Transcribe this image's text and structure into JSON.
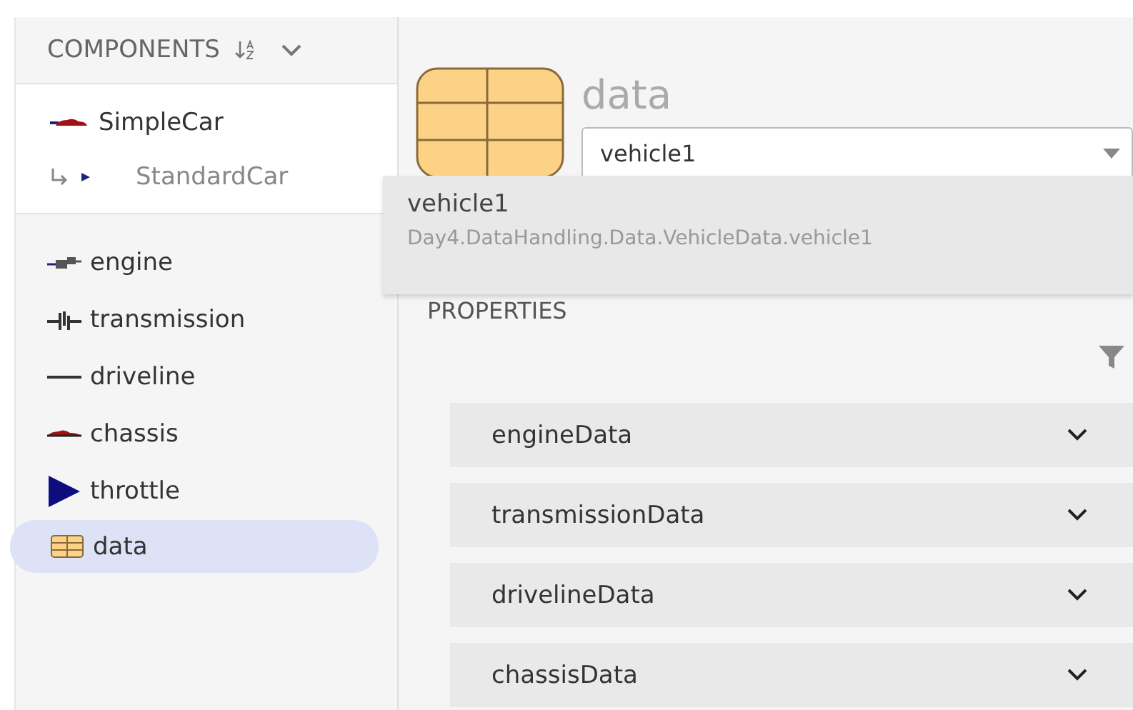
{
  "components_panel": {
    "title": "COMPONENTS",
    "expanded": true,
    "model": {
      "name": "SimpleCar",
      "kind": "car",
      "children": [
        {
          "name": "StandardCar",
          "kind": "port"
        }
      ]
    },
    "items": [
      {
        "name": "engine",
        "kind": "engine",
        "selected": false
      },
      {
        "name": "transmission",
        "kind": "transmission",
        "selected": false
      },
      {
        "name": "driveline",
        "kind": "line",
        "selected": false
      },
      {
        "name": "chassis",
        "kind": "car",
        "selected": false
      },
      {
        "name": "throttle",
        "kind": "triangle",
        "selected": false
      },
      {
        "name": "data",
        "kind": "table",
        "selected": true
      }
    ]
  },
  "detail": {
    "title": "data",
    "select": {
      "value": "vehicle1"
    },
    "dropdown": {
      "options": [
        {
          "name": "vehicle1",
          "path": "Day4.DataHandling.Data.VehicleData.vehicle1"
        }
      ]
    },
    "properties_heading": "PROPERTIES",
    "groups": [
      {
        "name": "engineData",
        "expanded": false
      },
      {
        "name": "transmissionData",
        "expanded": false
      },
      {
        "name": "drivelineData",
        "expanded": false
      },
      {
        "name": "chassisData",
        "expanded": false
      }
    ]
  }
}
